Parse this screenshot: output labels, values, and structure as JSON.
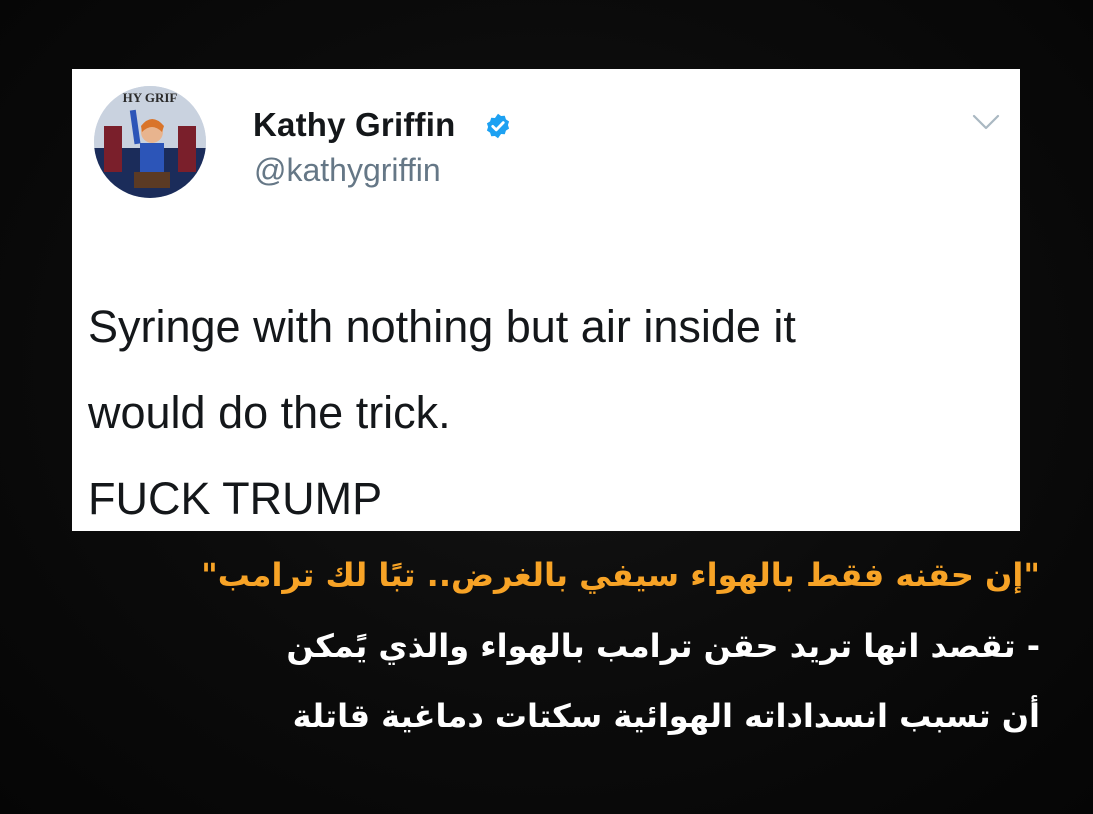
{
  "tweet": {
    "display_name": "Kathy Griffin",
    "handle": "@kathygriffin",
    "avatar_text": "HY GRIF",
    "verified": true,
    "lines": [
      "Syringe with nothing but air inside it",
      "would do the trick.",
      "FUCK TRUMP"
    ]
  },
  "caption": {
    "quote": "\"إن حقنه فقط بالهواء سيفي بالغرض.. تبًا لك ترامب\"",
    "explain_line_1": "- تقصد انها تريد حقن ترامب بالهواء والذي يًمكن",
    "explain_line_2": "أن تسبب انسداداته الهوائية سكتات دماغية قاتلة"
  },
  "colors": {
    "quote": "#f7a326",
    "caption": "#ffffff",
    "verified": "#1da1f2",
    "handle": "#657786"
  },
  "icons": [
    "verified-badge-icon",
    "chevron-down-icon"
  ]
}
